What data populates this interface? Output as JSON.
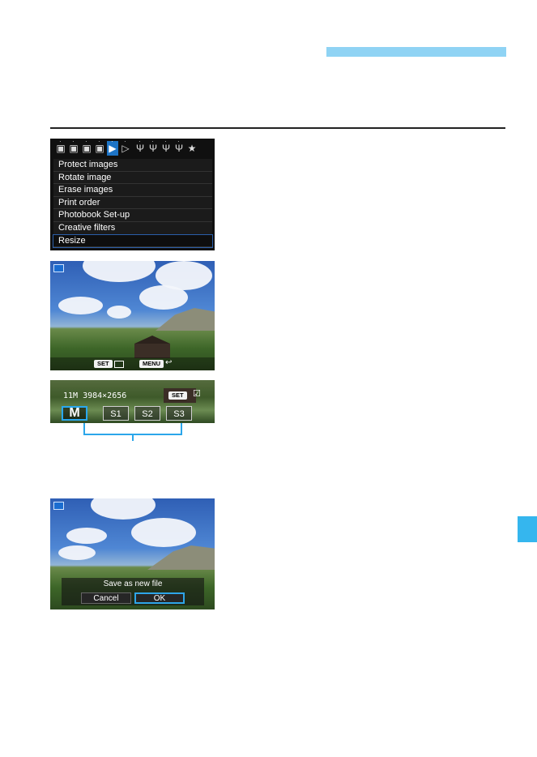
{
  "colors": {
    "accent_bar": "#8fd3f4",
    "side_tab": "#35b6ee",
    "rule": "#222222",
    "selection": "#29a8ef"
  },
  "menu_screen": {
    "tabs": [
      {
        "icon": "camera-icon",
        "glyph": "▣"
      },
      {
        "icon": "camera-icon",
        "glyph": "▣"
      },
      {
        "icon": "camera-icon",
        "glyph": "▣"
      },
      {
        "icon": "camera-icon",
        "glyph": "▣"
      },
      {
        "icon": "playback-icon",
        "glyph": "▶",
        "active": true
      },
      {
        "icon": "playback-icon",
        "glyph": "▷"
      },
      {
        "icon": "wrench-icon",
        "glyph": "Ψ"
      },
      {
        "icon": "wrench-icon",
        "glyph": "Ψ"
      },
      {
        "icon": "wrench-icon",
        "glyph": "Ψ"
      },
      {
        "icon": "wrench-icon",
        "glyph": "Ψ"
      },
      {
        "icon": "star-icon",
        "glyph": "★"
      }
    ],
    "items": [
      "Protect images",
      "Rotate image",
      "Erase images",
      "Print order",
      "Photobook Set-up",
      "Creative filters",
      "Resize"
    ],
    "selected_item": "Resize"
  },
  "photo_screen_1": {
    "set_label": "SET",
    "menu_label": "MENU",
    "icons": [
      "resize-icon",
      "return-icon"
    ]
  },
  "resize_screen": {
    "size_info": "11M 3984×2656",
    "set_label": "SET",
    "options": [
      "M",
      "S1",
      "S2",
      "S3"
    ],
    "selected_option": "M"
  },
  "confirm_screen": {
    "message": "Save as new file",
    "cancel_label": "Cancel",
    "ok_label": "OK"
  }
}
